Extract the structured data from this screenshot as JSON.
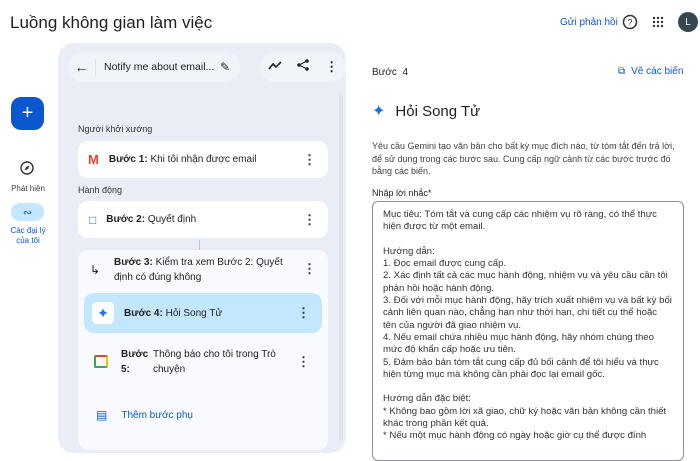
{
  "header": {
    "title": "Luồng không gian làm việc",
    "feedback": "Gửi phản hồi",
    "avatar": "L"
  },
  "rail": {
    "discover": "Phát hiện",
    "agents": "Các đại lý của tôi"
  },
  "flow": {
    "name": "Notify me about email...",
    "trigger_label": "Người khởi xướng",
    "actions_label": "Hành động",
    "steps": [
      {
        "prefix": "Bước 1:",
        "text": "Khi tôi nhận được email"
      },
      {
        "prefix": "Bước 2:",
        "text": "Quyết định"
      },
      {
        "prefix": "Bước 3:",
        "text": "Kiểm tra xem Bước 2: Quyết định có đúng không"
      },
      {
        "prefix": "Bước 4:",
        "text": "Hỏi Song Tử"
      },
      {
        "prefix": "Bước 5:",
        "text": "Thông báo cho tôi trong Trò chuyện"
      }
    ],
    "add_substep": "Thêm bước phụ"
  },
  "detail": {
    "step": "Bước  4",
    "variables": "Vẽ các biến",
    "title": "Hỏi Song Tử",
    "description": "Yêu cầu Gemini tạo văn bản cho bất kỳ mục đích nào, từ tóm tắt đến trả lời, để sử dụng trong các bước sau. Cung cấp ngữ cảnh từ các bước trước đó bằng các biến.",
    "prompt_label": "Nhập lời nhắc*",
    "prompt": "Mục tiêu: Tóm tắt và cung cấp các nhiệm vụ rõ ràng, có thể thực hiện được từ một email.\n\nHướng dẫn:\n1. Đọc email được cung cấp.\n2. Xác định tất cả các mục hành động, nhiệm vụ và yêu cầu cần tôi phản hồi hoặc hành động.\n3. Đối với mỗi mục hành động, hãy trích xuất nhiệm vụ và bất kỳ bối cảnh liên quan nào, chẳng hạn như thời hạn, chi tiết cụ thể hoặc tên của người đã giao nhiệm vụ.\n4. Nếu email chứa nhiều mục hành động, hãy nhóm chúng theo mức độ khẩn cấp hoặc ưu tiên.\n5. Đảm bảo bản tóm tắt cung cấp đủ bối cảnh để tôi hiểu và thực hiện từng mục mà không cần phải đọc lại email gốc.\n\nHướng dẫn đặc biệt:\n* Không bao gồm lời xã giao, chữ ký hoặc văn bản không cần thiết khác trong phần kết quả.\n* Nếu một mục hành động có ngày hoặc giờ cụ thể được đính"
  },
  "colors": {
    "accent": "#0b57d0",
    "selected": "#c2e7ff",
    "panel": "#e9eef6"
  }
}
